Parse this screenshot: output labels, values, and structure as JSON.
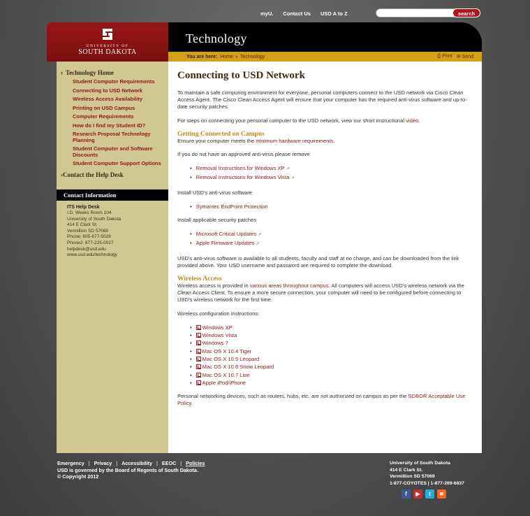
{
  "topbar": {
    "links": [
      "myU.",
      "Contact Us",
      "USD A to Z"
    ],
    "search_placeholder": "",
    "search_button": "search"
  },
  "logo": {
    "university_of": "UNIVERSITY OF",
    "name": "SOUTH DAKOTA"
  },
  "header": {
    "title": "Technology"
  },
  "breadcrumb": {
    "label": "You are here:",
    "home": "Home",
    "sep": "»",
    "current": "Technology",
    "print": "Print",
    "send": "Send"
  },
  "sidebar": {
    "section_title": "Technology Home",
    "items": [
      "Student Computer Requirements",
      "Connecting to USD Network",
      "Wireless Access Availability",
      "Printing on USD Campus",
      "Computer Requirements",
      "How do I find my Student ID?",
      "Research Proposal Technology Planning",
      "Student Computer and Software Discounts",
      "Student Computer Support Options"
    ],
    "section2_title": "Contact the Help Desk",
    "contact_title": "Contact Information",
    "contact_lines": [
      "ITS Help Desk",
      "I.D. Weeks Room 104",
      "University of South Dakota",
      "414 E Clark St.",
      "Vermillion SD 57069",
      "Phone: 605-677-5028",
      "Phone2: 877-225-0027",
      "helpdesk@usd.edu",
      "www.usd.edu/technology"
    ]
  },
  "main": {
    "title": "Connecting to USD Network",
    "intro": "To maintain a safe computing environment for everyone, personal computers connect to the USD network via Cisco Clean Access Agent. The Cisco Clean Access Agent will ensure that your computer has the required anti-virus software and up-to-date security patches.",
    "video_pre": "For steps on connecting your personal computer to the USD network, view our short instructional",
    "video_link": "video",
    "video_post": ".",
    "h_campus": "Getting Connected on Campus",
    "ensure_pre": "Ensure your computer meets the",
    "ensure_link": "minimum hardware requirements",
    "ensure_post": ".",
    "remove_text": "If you do not have an approved anti-virus please remove",
    "remove_links": [
      "Removal Instructions for Windows XP",
      "Removal Instructions for Windows Vista"
    ],
    "install_av": "Install USD's anti-virus software",
    "av_link": "Symantec EndPoint Protection",
    "install_patches": "Install applicable security patches",
    "patch_links": [
      "Microsoft Critical Updates",
      "Apple Firmware Updates"
    ],
    "av_note": "USD's anti-virus software is available to all students, faculty and staff at no charge, and can be downloaded from the link provided above. Your USD username and password are required to complete the download.",
    "h_wireless": "Wireless Access",
    "wireless_pre": "Wireless access is provided in",
    "wireless_link": "various areas throughout campus",
    "wireless_post": ". All computers will access USD's wireless network via the Clean Access Client. To ensure a more secure connection, your computer will need to be configured before connecting to USD's wireless network for the first time.",
    "wireless_config": "Wireless configuration instructions:",
    "config_links": [
      "Windows XP",
      "Windows Vista",
      "Windows 7",
      "Mac OS X 10.4 Tiger",
      "Mac OS X 10.5 Leopard",
      "Mac OS X 10.6 Snow Leopard",
      "Mac OS X 10.7 Lion",
      "Apple iPod/iPhone"
    ],
    "policy_pre": "Personal networking devices, such as routers, hubs, etc. are not authorized on campus as per the",
    "policy_link": "SDBOR Acceptable Use Policy",
    "policy_post": "."
  },
  "footer": {
    "links": [
      "Emergency",
      "Privacy",
      "Accessibility",
      "EEOC",
      "Policies"
    ],
    "governed_pre": "USD is governed by the",
    "governed_link": "Board of Regents",
    "governed_post": "of South Dakota.",
    "copyright": "© Copyright 2012",
    "address": [
      "University of South Dakota",
      "414 E Clark St.",
      "Vermillion SD 57069",
      "1-877-COYOTES | 1-877-269-6837"
    ],
    "social": [
      "facebook-icon",
      "youtube-icon",
      "twitter-icon",
      "rss-icon"
    ]
  }
}
